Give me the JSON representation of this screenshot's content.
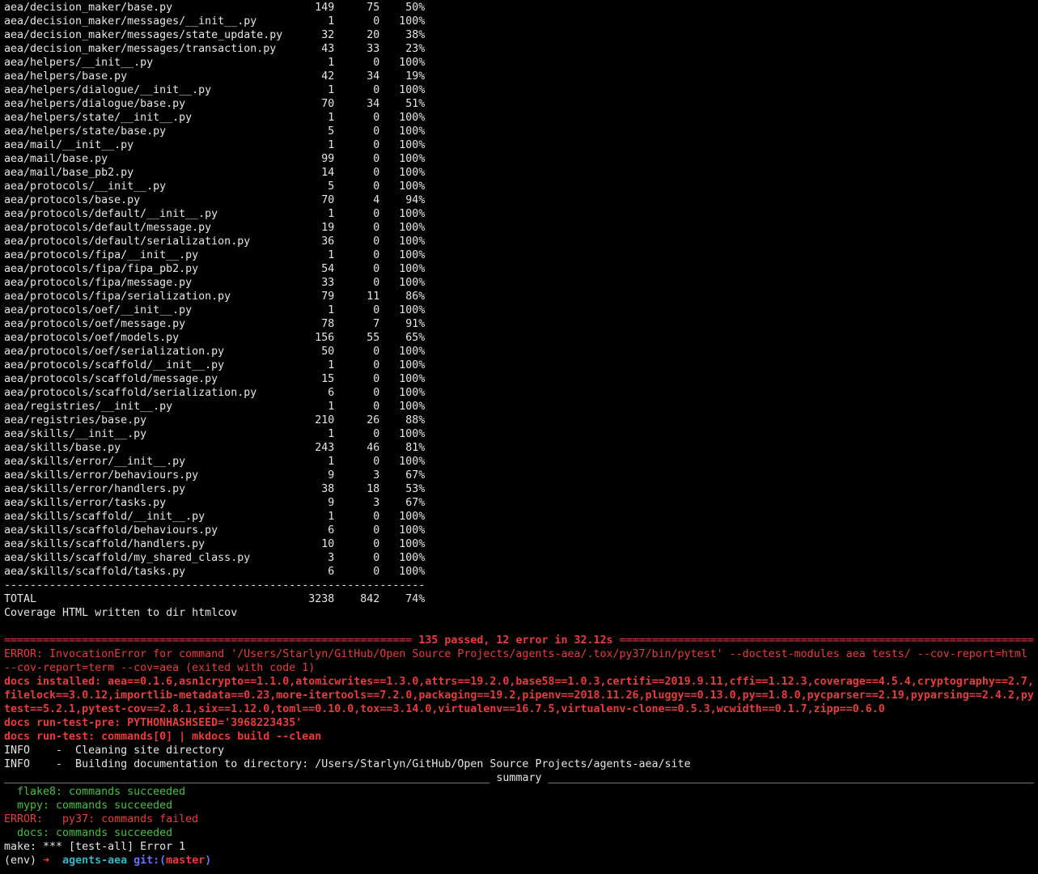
{
  "coverage": {
    "rows": [
      {
        "name": "aea/decision_maker/base.py",
        "stmts": "149",
        "miss": "75",
        "cover": "50%"
      },
      {
        "name": "aea/decision_maker/messages/__init__.py",
        "stmts": "1",
        "miss": "0",
        "cover": "100%"
      },
      {
        "name": "aea/decision_maker/messages/state_update.py",
        "stmts": "32",
        "miss": "20",
        "cover": "38%"
      },
      {
        "name": "aea/decision_maker/messages/transaction.py",
        "stmts": "43",
        "miss": "33",
        "cover": "23%"
      },
      {
        "name": "aea/helpers/__init__.py",
        "stmts": "1",
        "miss": "0",
        "cover": "100%"
      },
      {
        "name": "aea/helpers/base.py",
        "stmts": "42",
        "miss": "34",
        "cover": "19%"
      },
      {
        "name": "aea/helpers/dialogue/__init__.py",
        "stmts": "1",
        "miss": "0",
        "cover": "100%"
      },
      {
        "name": "aea/helpers/dialogue/base.py",
        "stmts": "70",
        "miss": "34",
        "cover": "51%"
      },
      {
        "name": "aea/helpers/state/__init__.py",
        "stmts": "1",
        "miss": "0",
        "cover": "100%"
      },
      {
        "name": "aea/helpers/state/base.py",
        "stmts": "5",
        "miss": "0",
        "cover": "100%"
      },
      {
        "name": "aea/mail/__init__.py",
        "stmts": "1",
        "miss": "0",
        "cover": "100%"
      },
      {
        "name": "aea/mail/base.py",
        "stmts": "99",
        "miss": "0",
        "cover": "100%"
      },
      {
        "name": "aea/mail/base_pb2.py",
        "stmts": "14",
        "miss": "0",
        "cover": "100%"
      },
      {
        "name": "aea/protocols/__init__.py",
        "stmts": "5",
        "miss": "0",
        "cover": "100%"
      },
      {
        "name": "aea/protocols/base.py",
        "stmts": "70",
        "miss": "4",
        "cover": "94%"
      },
      {
        "name": "aea/protocols/default/__init__.py",
        "stmts": "1",
        "miss": "0",
        "cover": "100%"
      },
      {
        "name": "aea/protocols/default/message.py",
        "stmts": "19",
        "miss": "0",
        "cover": "100%"
      },
      {
        "name": "aea/protocols/default/serialization.py",
        "stmts": "36",
        "miss": "0",
        "cover": "100%"
      },
      {
        "name": "aea/protocols/fipa/__init__.py",
        "stmts": "1",
        "miss": "0",
        "cover": "100%"
      },
      {
        "name": "aea/protocols/fipa/fipa_pb2.py",
        "stmts": "54",
        "miss": "0",
        "cover": "100%"
      },
      {
        "name": "aea/protocols/fipa/message.py",
        "stmts": "33",
        "miss": "0",
        "cover": "100%"
      },
      {
        "name": "aea/protocols/fipa/serialization.py",
        "stmts": "79",
        "miss": "11",
        "cover": "86%"
      },
      {
        "name": "aea/protocols/oef/__init__.py",
        "stmts": "1",
        "miss": "0",
        "cover": "100%"
      },
      {
        "name": "aea/protocols/oef/message.py",
        "stmts": "78",
        "miss": "7",
        "cover": "91%"
      },
      {
        "name": "aea/protocols/oef/models.py",
        "stmts": "156",
        "miss": "55",
        "cover": "65%"
      },
      {
        "name": "aea/protocols/oef/serialization.py",
        "stmts": "50",
        "miss": "0",
        "cover": "100%"
      },
      {
        "name": "aea/protocols/scaffold/__init__.py",
        "stmts": "1",
        "miss": "0",
        "cover": "100%"
      },
      {
        "name": "aea/protocols/scaffold/message.py",
        "stmts": "15",
        "miss": "0",
        "cover": "100%"
      },
      {
        "name": "aea/protocols/scaffold/serialization.py",
        "stmts": "6",
        "miss": "0",
        "cover": "100%"
      },
      {
        "name": "aea/registries/__init__.py",
        "stmts": "1",
        "miss": "0",
        "cover": "100%"
      },
      {
        "name": "aea/registries/base.py",
        "stmts": "210",
        "miss": "26",
        "cover": "88%"
      },
      {
        "name": "aea/skills/__init__.py",
        "stmts": "1",
        "miss": "0",
        "cover": "100%"
      },
      {
        "name": "aea/skills/base.py",
        "stmts": "243",
        "miss": "46",
        "cover": "81%"
      },
      {
        "name": "aea/skills/error/__init__.py",
        "stmts": "1",
        "miss": "0",
        "cover": "100%"
      },
      {
        "name": "aea/skills/error/behaviours.py",
        "stmts": "9",
        "miss": "3",
        "cover": "67%"
      },
      {
        "name": "aea/skills/error/handlers.py",
        "stmts": "38",
        "miss": "18",
        "cover": "53%"
      },
      {
        "name": "aea/skills/error/tasks.py",
        "stmts": "9",
        "miss": "3",
        "cover": "67%"
      },
      {
        "name": "aea/skills/scaffold/__init__.py",
        "stmts": "1",
        "miss": "0",
        "cover": "100%"
      },
      {
        "name": "aea/skills/scaffold/behaviours.py",
        "stmts": "6",
        "miss": "0",
        "cover": "100%"
      },
      {
        "name": "aea/skills/scaffold/handlers.py",
        "stmts": "10",
        "miss": "0",
        "cover": "100%"
      },
      {
        "name": "aea/skills/scaffold/my_shared_class.py",
        "stmts": "3",
        "miss": "0",
        "cover": "100%"
      },
      {
        "name": "aea/skills/scaffold/tasks.py",
        "stmts": "6",
        "miss": "0",
        "cover": "100%"
      }
    ],
    "total": {
      "name": "TOTAL",
      "stmts": "3238",
      "miss": "842",
      "cover": "74%"
    },
    "html_report_line": "Coverage HTML written to dir htmlcov"
  },
  "pytest": {
    "result_banner": "135 passed, 12 error in 32.12s"
  },
  "tox": {
    "invocation_error": [
      "ERROR: InvocationError for command '/Users/Starlyn/GitHub/Open Source Projects/agents-aea/.tox/py37/bin/pytest' --doctest-modules aea tests/ --cov-report=html",
      "--cov-report=term --cov=aea (exited with code 1)"
    ],
    "docs_installed": [
      "docs installed: aea==0.1.6,asn1crypto==1.1.0,atomicwrites==1.3.0,attrs==19.2.0,base58==1.0.3,certifi==2019.9.11,cffi==1.12.3,coverage==4.5.4,cryptography==2.7,",
      "filelock==3.0.12,importlib-metadata==0.23,more-itertools==7.2.0,packaging==19.2,pipenv==2018.11.26,pluggy==0.13.0,py==1.8.0,pycparser==2.19,pyparsing==2.4.2,py",
      "test==5.2.1,pytest-cov==2.8.1,six==1.12.0,toml==0.10.0,tox==3.14.0,virtualenv==16.7.5,virtualenv-clone==0.5.3,wcwidth==0.1.7,zipp==0.6.0"
    ],
    "docs_run_test_pre": "docs run-test-pre: PYTHONHASHSEED='3968223435'",
    "docs_run_test": "docs run-test: commands[0] | mkdocs build --clean"
  },
  "mkdocs": {
    "info": [
      "INFO    -  Cleaning site directory",
      "INFO    -  Building documentation to directory: /Users/Starlyn/GitHub/Open Source Projects/agents-aea/site"
    ]
  },
  "summary": {
    "title": "summary",
    "results": [
      "  flake8: commands succeeded",
      "  mypy: commands succeeded",
      "ERROR:   py37: commands failed",
      "  docs: commands succeeded"
    ]
  },
  "make_error": "make: *** [test-all] Error 1",
  "prompt": {
    "env": "(env)",
    "arrow": "➜",
    "directory": "agents-aea",
    "git_prefix": "git:(",
    "branch": "master",
    "git_suffix": ")"
  },
  "colors": {
    "background": "#000000",
    "text": "#e6e6e6",
    "error": "#ec3b3b",
    "success": "#44c23c",
    "directory": "#38b2c6",
    "git": "#6c70ff",
    "branch": "#ec3b3b"
  }
}
